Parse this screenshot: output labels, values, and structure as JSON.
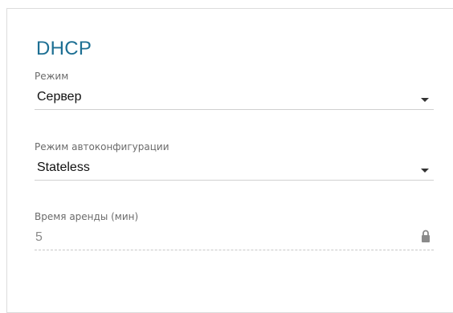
{
  "section": {
    "title": "DHCP"
  },
  "fields": {
    "mode": {
      "label": "Режим",
      "value": "Сервер"
    },
    "autoconfig_mode": {
      "label": "Режим автоконфигурации",
      "value": "Stateless"
    },
    "lease_time": {
      "label": "Время аренды (мин)",
      "value": "5",
      "icon": "lock-icon"
    }
  },
  "colors": {
    "title": "#1d6f93",
    "label": "#6b6b6b",
    "value": "#111111",
    "disabled_value": "#8a8a8a",
    "border": "#d0d0d0"
  }
}
